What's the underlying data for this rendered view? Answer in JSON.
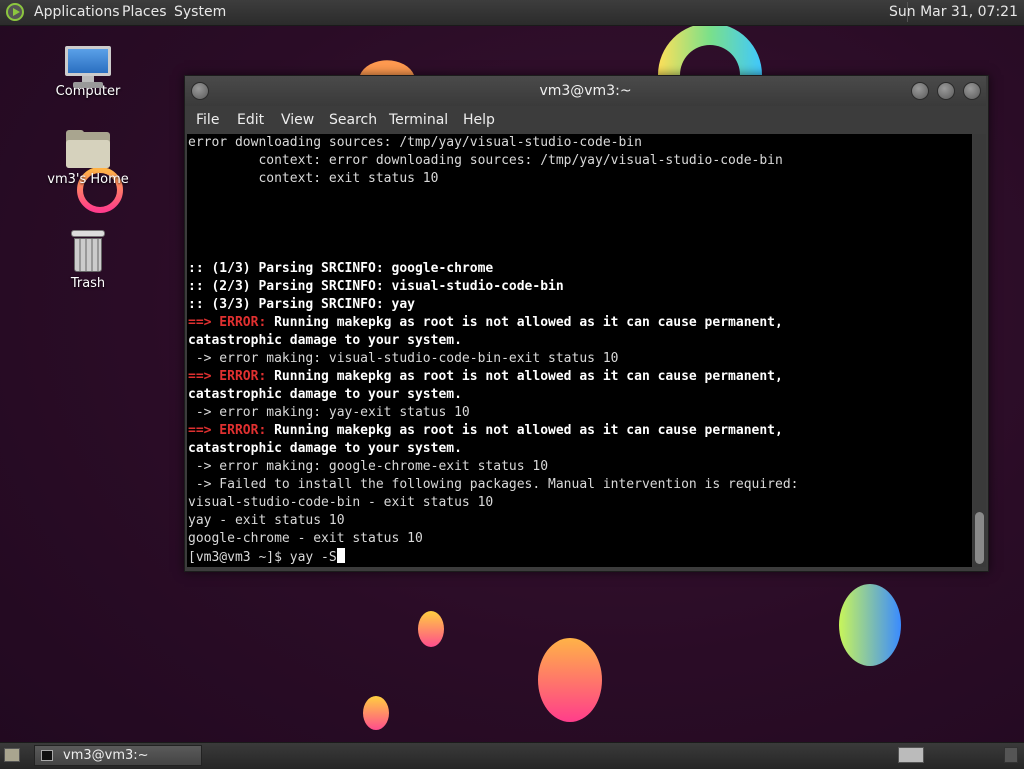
{
  "top_panel": {
    "menus": [
      "Applications",
      "Places",
      "System"
    ],
    "clock": "Sun Mar 31, 07:21"
  },
  "desktop": {
    "icons": [
      {
        "label": "Computer",
        "icon": "computer-icon"
      },
      {
        "label": "vm3's Home",
        "icon": "home-folder-icon"
      },
      {
        "label": "Trash",
        "icon": "trash-icon"
      }
    ]
  },
  "window": {
    "title": "vm3@vm3:~",
    "menu": [
      "File",
      "Edit",
      "View",
      "Search",
      "Terminal",
      "Help"
    ],
    "terminal_lines": [
      [
        {
          "t": "error downloading sources: /tmp/yay/visual-studio-code-bin",
          "s": "n"
        }
      ],
      [
        {
          "t": "         context: error downloading sources: /tmp/yay/visual-studio-code-bin",
          "s": "n"
        }
      ],
      [
        {
          "t": "         context: exit status 10",
          "s": "n"
        }
      ],
      [],
      [],
      [],
      [],
      [
        {
          "t": ":: (1/3) Parsing SRCINFO: google-chrome",
          "s": "b"
        }
      ],
      [
        {
          "t": ":: (2/3) Parsing SRCINFO: visual-studio-code-bin",
          "s": "b"
        }
      ],
      [
        {
          "t": ":: (3/3) Parsing SRCINFO: yay",
          "s": "b"
        }
      ],
      [
        {
          "t": "==> ERROR: ",
          "s": "err"
        },
        {
          "t": "Running makepkg as root is not allowed as it can cause permanent,",
          "s": "b"
        }
      ],
      [
        {
          "t": "catastrophic damage to your system.",
          "s": "b"
        }
      ],
      [
        {
          "t": " -> error making: visual-studio-code-bin-exit status 10",
          "s": "n"
        }
      ],
      [
        {
          "t": "==> ERROR: ",
          "s": "err"
        },
        {
          "t": "Running makepkg as root is not allowed as it can cause permanent,",
          "s": "b"
        }
      ],
      [
        {
          "t": "catastrophic damage to your system.",
          "s": "b"
        }
      ],
      [
        {
          "t": " -> error making: yay-exit status 10",
          "s": "n"
        }
      ],
      [
        {
          "t": "==> ERROR: ",
          "s": "err"
        },
        {
          "t": "Running makepkg as root is not allowed as it can cause permanent,",
          "s": "b"
        }
      ],
      [
        {
          "t": "catastrophic damage to your system.",
          "s": "b"
        }
      ],
      [
        {
          "t": " -> error making: google-chrome-exit status 10",
          "s": "n"
        }
      ],
      [
        {
          "t": " -> Failed to install the following packages. Manual intervention is required:",
          "s": "n"
        }
      ],
      [
        {
          "t": "visual-studio-code-bin - exit status 10",
          "s": "n"
        }
      ],
      [
        {
          "t": "yay - exit status 10",
          "s": "n"
        }
      ],
      [
        {
          "t": "google-chrome - exit status 10",
          "s": "n"
        }
      ]
    ],
    "prompt": "[vm3@vm3 ~]$ yay -S"
  },
  "taskbar": {
    "task_label": "vm3@vm3:~"
  },
  "colors": {
    "error": "#e03030",
    "desktop_bg": "#2a0c26"
  }
}
